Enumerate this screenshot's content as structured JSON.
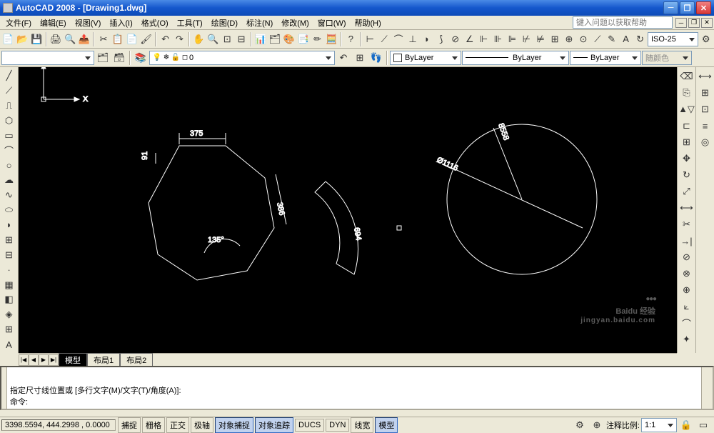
{
  "title": "AutoCAD 2008 - [Drawing1.dwg]",
  "help_placeholder": "键入问题以获取帮助",
  "menu": [
    "文件(F)",
    "编辑(E)",
    "视图(V)",
    "插入(I)",
    "格式(O)",
    "工具(T)",
    "绘图(D)",
    "标注(N)",
    "修改(M)",
    "窗口(W)",
    "帮助(H)"
  ],
  "dim_style": "ISO-25",
  "layer": {
    "current": "0"
  },
  "props": {
    "color": "ByLayer",
    "linetype": "ByLayer",
    "lineweight": "ByLayer",
    "plotstyle": "随颜色"
  },
  "tabs": {
    "nav": [
      "|◀",
      "◀",
      "▶",
      "▶|"
    ],
    "items": [
      "模型",
      "布局1",
      "布局2"
    ],
    "active": 0
  },
  "command": {
    "history1": "指定尺寸线位置或 [多行文字(M)/文字(T)/角度(A)]:",
    "history2": "",
    "prompt": "命令:"
  },
  "status": {
    "coords": "3398.5594, 444.2998 , 0.0000",
    "toggles": [
      "捕捉",
      "栅格",
      "正交",
      "极轴",
      "对象捕捉",
      "对象追踪",
      "DUCS",
      "DYN",
      "线宽",
      "模型"
    ],
    "scale_label": "注释比例:",
    "scale_value": "1:1"
  },
  "dimensions": {
    "d1": "375",
    "d2": "91",
    "d3": "386",
    "d4": "135°",
    "d5": "694",
    "d6": "Ø1116",
    "d7": "8558"
  },
  "watermark": {
    "main": "Baidu 经验",
    "sub": "jingyan.baidu.com"
  }
}
